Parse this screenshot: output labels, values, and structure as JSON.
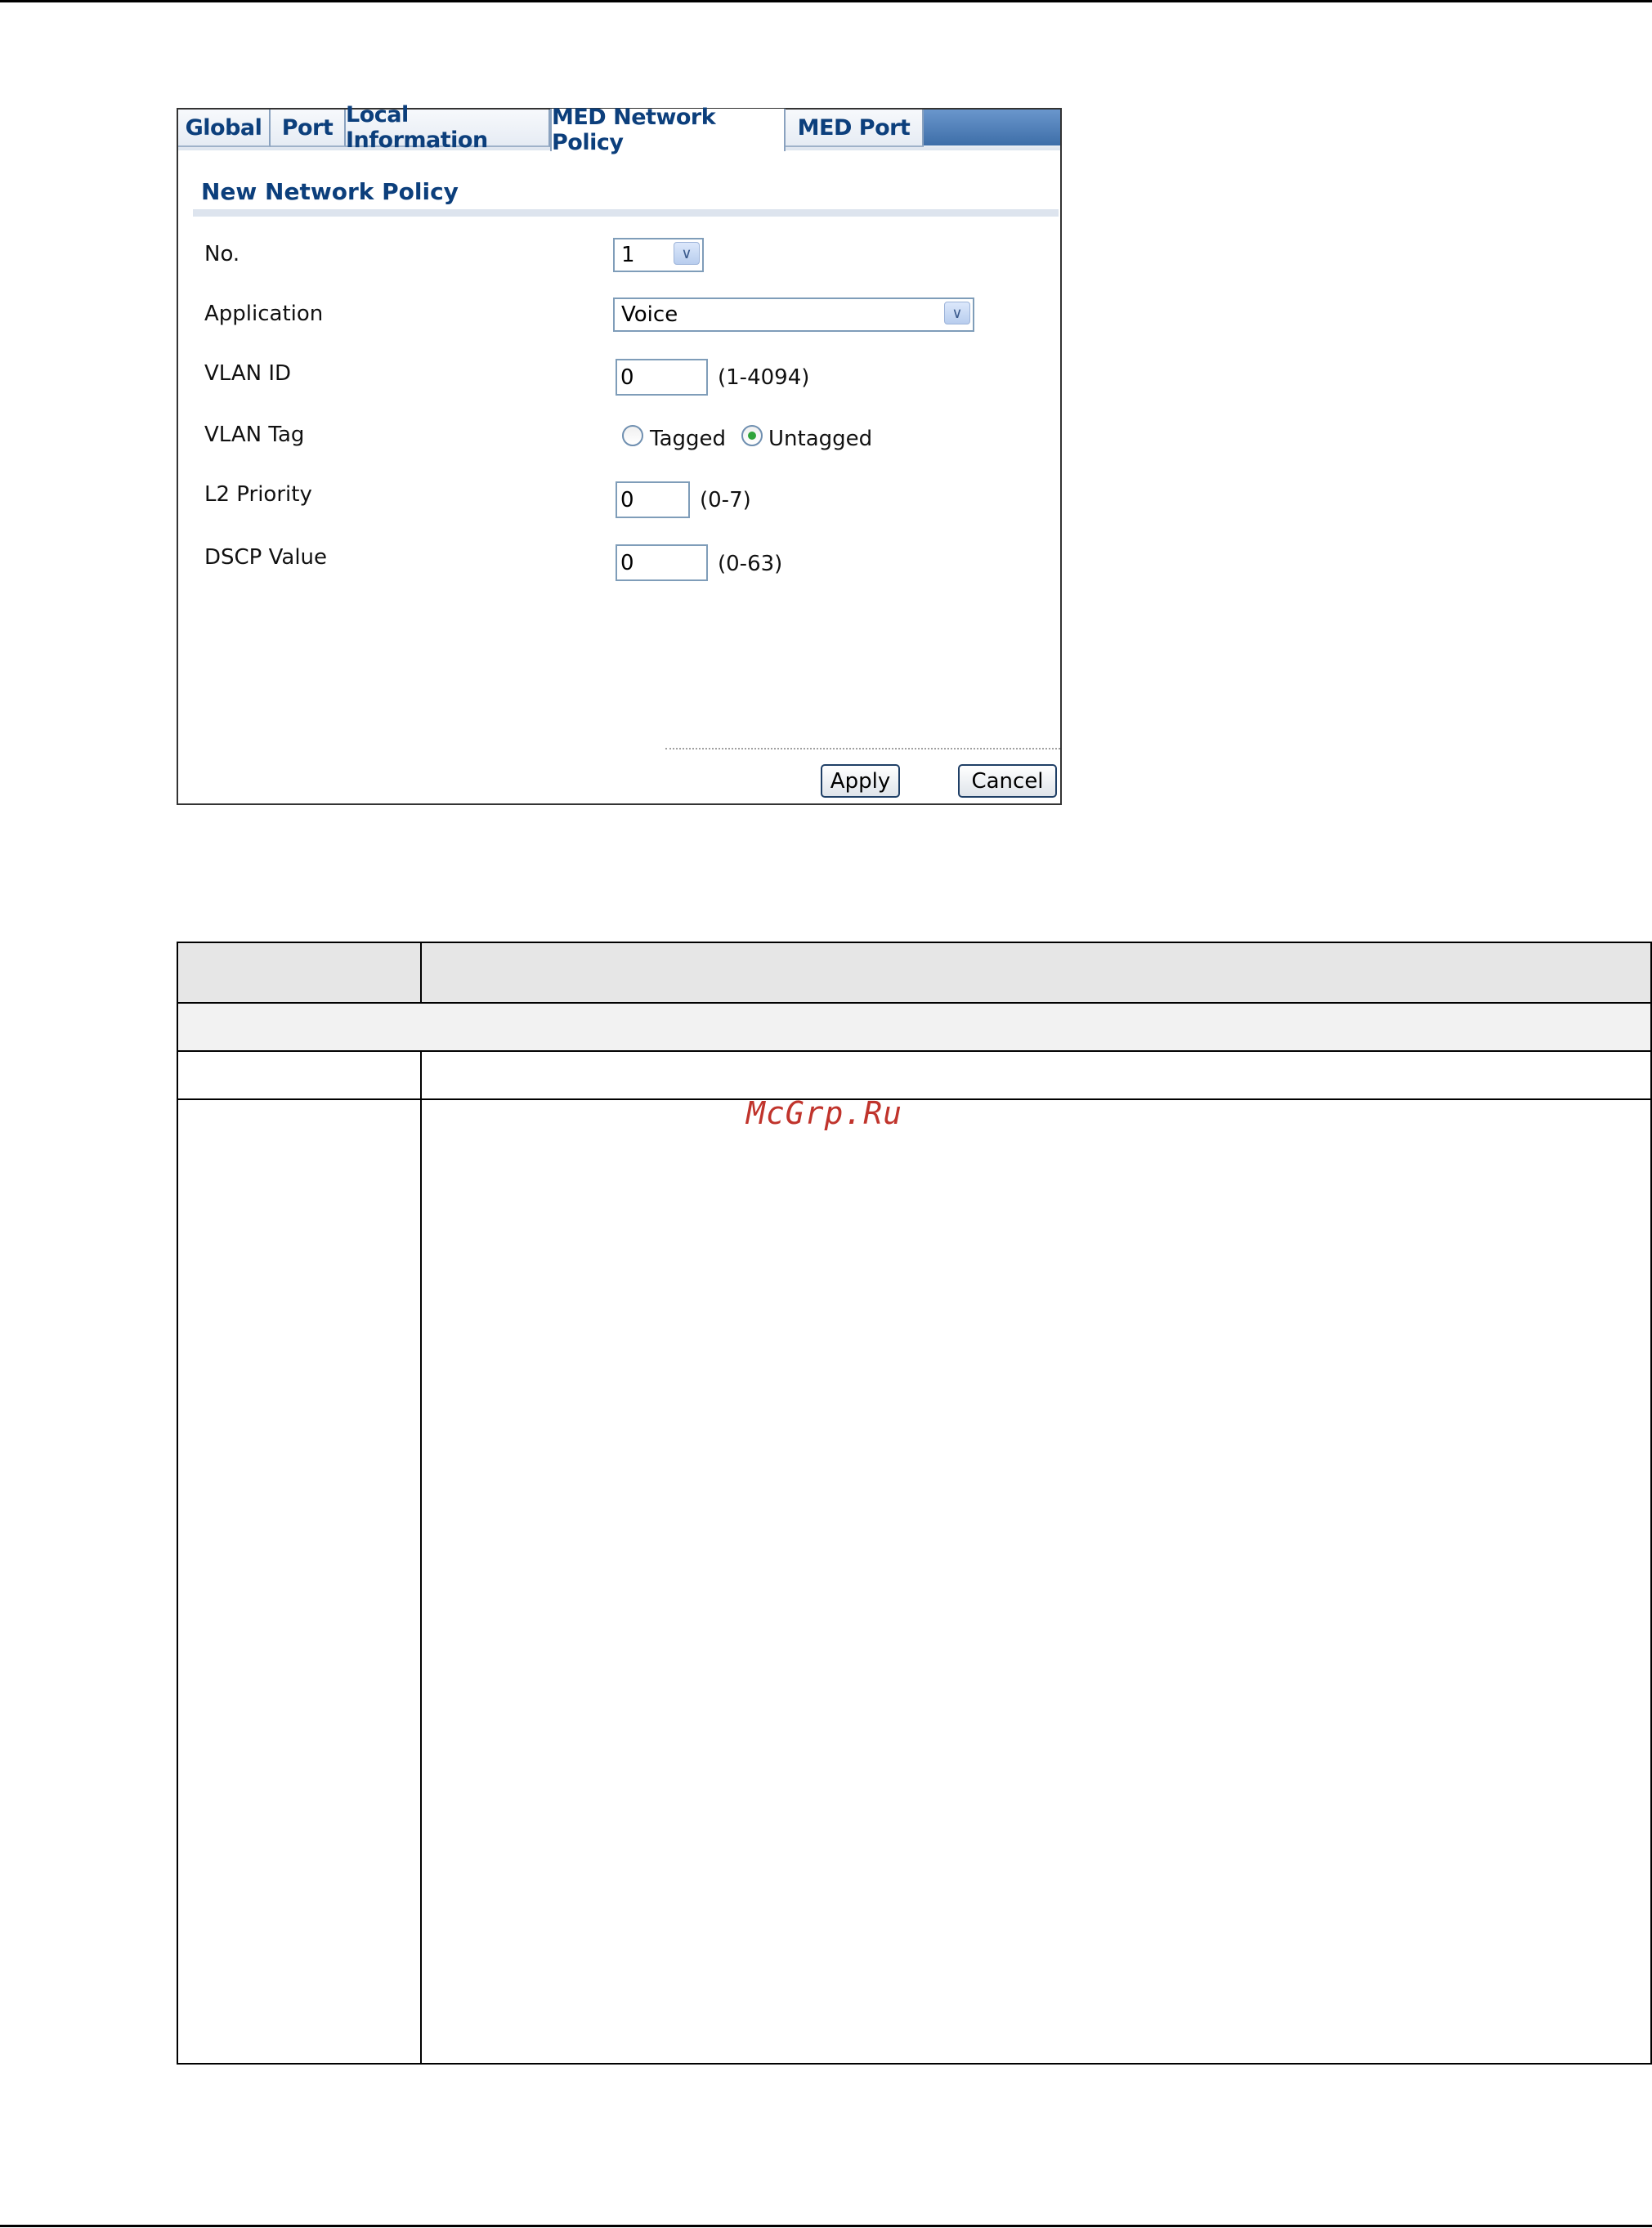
{
  "tabs": {
    "global": "Global",
    "port": "Port",
    "local_information": "Local Information",
    "med_network_policy": "MED Network Policy",
    "med_port": "MED Port"
  },
  "form": {
    "title": "New Network Policy",
    "no_label": "No.",
    "no_value": "1",
    "application_label": "Application",
    "application_value": "Voice",
    "vlan_id_label": "VLAN ID",
    "vlan_id_value": "0",
    "vlan_id_range": "(1-4094)",
    "vlan_tag_label": "VLAN Tag",
    "vlan_tag_tagged": "Tagged",
    "vlan_tag_untagged": "Untagged",
    "vlan_tag_selected": "Untagged",
    "l2_priority_label": "L2 Priority",
    "l2_priority_value": "0",
    "l2_priority_range": "(0-7)",
    "dscp_label": "DSCP Value",
    "dscp_value": "0",
    "dscp_range": "(0-63)"
  },
  "buttons": {
    "apply": "Apply",
    "cancel": "Cancel"
  },
  "icons": {
    "dropdown": "chevron-down-icon",
    "radio_unchecked": "radio-unchecked-icon",
    "radio_checked": "radio-checked-icon"
  },
  "watermark": "McGrp.Ru"
}
